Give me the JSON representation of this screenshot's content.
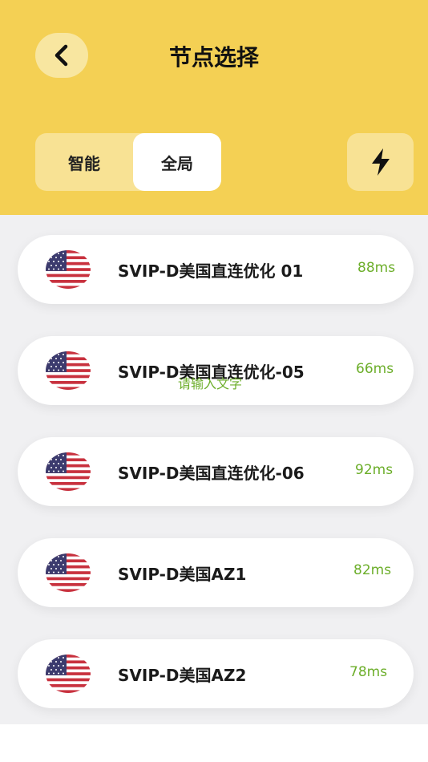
{
  "header": {
    "title": "节点选择",
    "back_icon": "chevron-left-icon",
    "mode_tabs": [
      {
        "label": "智能",
        "selected": false
      },
      {
        "label": "全局",
        "selected": true
      }
    ],
    "boost_icon": "lightning-bolt-icon"
  },
  "servers": [
    {
      "name": "SVIP-D美国直连优化 01",
      "latency": "88ms",
      "flag_icon": "us-flag-icon"
    },
    {
      "name": "SVIP-D美国直连优化-05",
      "latency": "66ms",
      "flag_icon": "us-flag-icon"
    },
    {
      "name": "SVIP-D美国直连优化-06",
      "latency": "92ms",
      "flag_icon": "us-flag-icon"
    },
    {
      "name": "SVIP-D美国AZ1",
      "latency": "82ms",
      "flag_icon": "us-flag-icon"
    },
    {
      "name": "SVIP-D美国AZ2",
      "latency": "78ms",
      "flag_icon": "us-flag-icon"
    }
  ],
  "overlay_placeholder": "请输入文字",
  "colors": {
    "header_bg": "#f4d054",
    "latency": "#6cae2a",
    "list_bg": "#f0f0f2"
  }
}
